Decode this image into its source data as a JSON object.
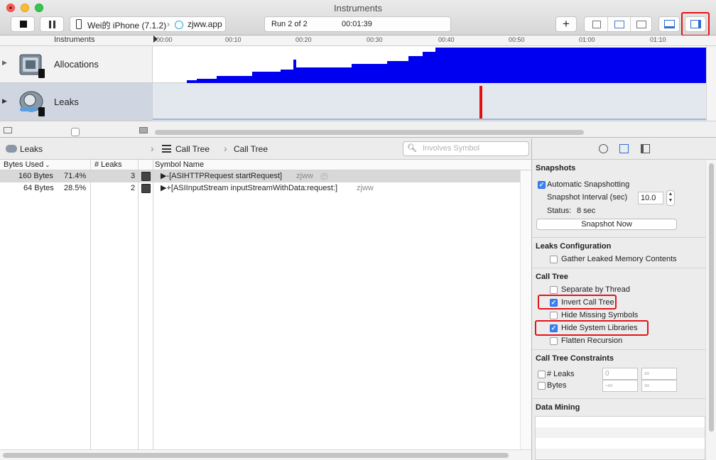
{
  "window": {
    "title": "Instruments"
  },
  "toolbar": {
    "device": "Wei的 iPhone (7.1.2)",
    "app": "zjww.app",
    "run_label": "Run 2 of 2",
    "elapsed": "00:01:39",
    "add_glyph": "+"
  },
  "timeline": {
    "header_label": "Instruments",
    "ticks": [
      "00:00",
      "00:10",
      "00:20",
      "00:30",
      "00:40",
      "00:50",
      "01:00",
      "01:10"
    ],
    "tracks": [
      {
        "name": "Allocations",
        "color": "#0000f0"
      },
      {
        "name": "Leaks",
        "marker_color": "#e01010"
      }
    ]
  },
  "jumpbar": {
    "instrument": "Leaks",
    "view": "Call Tree",
    "subview": "Call Tree",
    "search_placeholder": "Involves Symbol"
  },
  "table": {
    "columns": [
      "Bytes Used",
      "# Leaks",
      "Symbol Name"
    ],
    "rows": [
      {
        "bytes": "160 Bytes",
        "percent": "71.4%",
        "leaks": "3",
        "symbol": "▶-[ASIHTTPRequest startRequest]",
        "library": "zjww"
      },
      {
        "bytes": "64 Bytes",
        "percent": "28.5%",
        "leaks": "2",
        "symbol": "▶+[ASIInputStream inputStreamWithData:request:]",
        "library": "zjww"
      }
    ]
  },
  "inspector": {
    "snapshots": {
      "title": "Snapshots",
      "auto_label": "Automatic Snapshotting",
      "auto_checked": true,
      "interval_label": "Snapshot Interval (sec)",
      "interval_value": "10.0",
      "status_label": "Status:",
      "status_value": "8 sec",
      "snapshot_button": "Snapshot Now"
    },
    "leaks_config": {
      "title": "Leaks Configuration",
      "gather_label": "Gather Leaked Memory Contents"
    },
    "call_tree": {
      "title": "Call Tree",
      "options": [
        {
          "label": "Separate by Thread",
          "checked": false
        },
        {
          "label": "Invert Call Tree",
          "checked": true
        },
        {
          "label": "Hide Missing Symbols",
          "checked": false
        },
        {
          "label": "Hide System Libraries",
          "checked": true
        },
        {
          "label": "Flatten Recursion",
          "checked": false
        }
      ]
    },
    "constraints": {
      "title": "Call Tree Constraints",
      "leaks_label": "# Leaks",
      "leaks_min": "0",
      "leaks_max": "∞",
      "bytes_label": "Bytes",
      "bytes_min": "-∞",
      "bytes_max": "∞"
    },
    "data_mining": {
      "title": "Data Mining"
    }
  },
  "colors": {
    "highlight": "#e3151a",
    "accent": "#3a83f6"
  }
}
